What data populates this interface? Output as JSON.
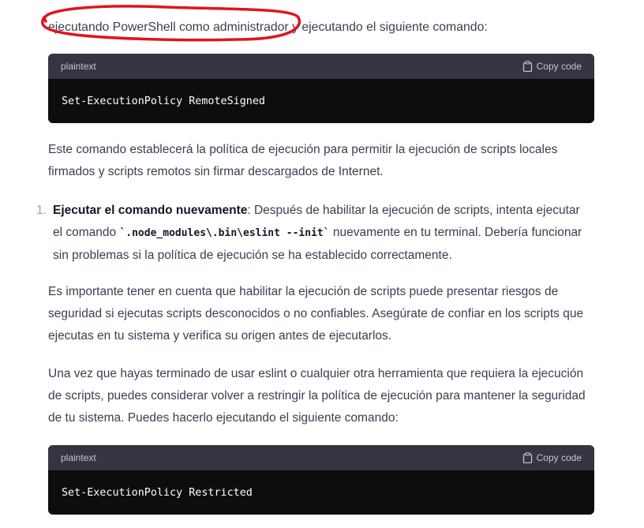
{
  "intro": {
    "highlighted": "ejecutando PowerShell como administrador",
    "rest": " y ejecutando el siguiente comando:"
  },
  "code_block_1": {
    "lang": "plaintext",
    "copy_label": "Copy code",
    "code": "Set-ExecutionPolicy RemoteSigned"
  },
  "para_1": "Este comando establecerá la política de ejecución para permitir la ejecución de scripts locales firmados y scripts remotos sin firmar descargados de Internet.",
  "list_item_1": {
    "number": "1.",
    "title": "Ejecutar el comando nuevamente",
    "text_a": ": Después de habilitar la ejecución de scripts, intenta ejecutar el comando ",
    "code": "`.node_modules\\.bin\\eslint --init`",
    "text_b": " nuevamente en tu terminal. Debería funcionar sin problemas si la política de ejecución se ha establecido correctamente."
  },
  "para_2": "Es importante tener en cuenta que habilitar la ejecución de scripts puede presentar riesgos de seguridad si ejecutas scripts desconocidos o no confiables. Asegúrate de confiar en los scripts que ejecutas en tu sistema y verifica su origen antes de ejecutarlos.",
  "para_3": "Una vez que hayas terminado de usar eslint o cualquier otra herramienta que requiera la ejecución de scripts, puedes considerar volver a restringir la política de ejecución para mantener la seguridad de tu sistema. Puedes hacerlo ejecutando el siguiente comando:",
  "code_block_2": {
    "lang": "plaintext",
    "copy_label": "Copy code",
    "code": "Set-ExecutionPolicy Restricted"
  },
  "colors": {
    "annotation": "#e0141e",
    "code_header": "#343541",
    "code_body": "#0d0d0d",
    "text": "#374151"
  },
  "icons": {
    "copy": "clipboard-icon"
  }
}
